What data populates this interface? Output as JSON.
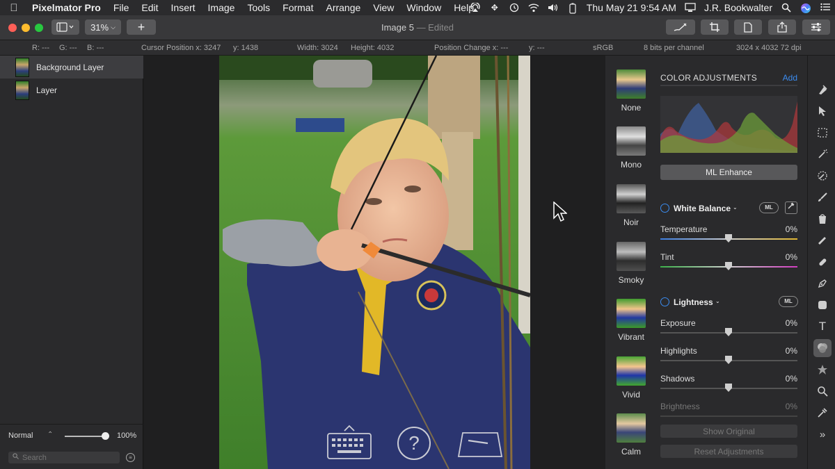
{
  "menubar": {
    "app_name": "Pixelmator Pro",
    "items": [
      "File",
      "Edit",
      "Insert",
      "Image",
      "Tools",
      "Format",
      "Arrange",
      "View",
      "Window",
      "Help"
    ],
    "clock": "Thu May 21  9:54 AM",
    "user": "J.R. Bookwalter"
  },
  "toolbar": {
    "zoom": "31%",
    "title": "Image 5",
    "edited": "— Edited"
  },
  "infobar": {
    "r": "R: ---",
    "g": "G: ---",
    "b": "B: ---",
    "cursor_x": "Cursor Position x: 3247",
    "cursor_y": "y: 1438",
    "width": "Width: 3024",
    "height": "Height: 4032",
    "pos_change_x": "Position Change x: ---",
    "pos_change_y": "y: ---",
    "color_space": "sRGB",
    "bit_depth": "8 bits per channel",
    "dimensions": "3024 x 4032 72 dpi"
  },
  "layers": {
    "items": [
      {
        "label": "Background Layer",
        "selected": true
      },
      {
        "label": "Layer",
        "selected": false
      }
    ],
    "blend_mode": "Normal",
    "opacity": "100%",
    "opacity_value": 1.0,
    "search_placeholder": "Search"
  },
  "presets": [
    {
      "label": "None",
      "style": "color"
    },
    {
      "label": "Mono",
      "style": "mono"
    },
    {
      "label": "Noir",
      "style": "noir"
    },
    {
      "label": "Smoky",
      "style": "smoky"
    },
    {
      "label": "Vibrant",
      "style": "vibrant"
    },
    {
      "label": "Vivid",
      "style": "vivid"
    },
    {
      "label": "Calm",
      "style": "calm"
    }
  ],
  "adjustments": {
    "section_title": "COLOR ADJUSTMENTS",
    "add_label": "Add",
    "ml_enhance": "ML Enhance",
    "white_balance": {
      "title": "White Balance",
      "ml_badge": "ML",
      "temperature_label": "Temperature",
      "temperature_value": "0%",
      "tint_label": "Tint",
      "tint_value": "0%"
    },
    "lightness": {
      "title": "Lightness",
      "ml_badge": "ML",
      "exposure_label": "Exposure",
      "exposure_value": "0%",
      "highlights_label": "Highlights",
      "highlights_value": "0%",
      "shadows_label": "Shadows",
      "shadows_value": "0%",
      "brightness_label": "Brightness",
      "brightness_value": "0%"
    },
    "show_original": "Show Original",
    "reset": "Reset Adjustments"
  },
  "colors": {
    "accent": "#3b8cf0",
    "close": "#ff5f57",
    "minimize": "#febc2e",
    "maximize": "#28c840"
  }
}
